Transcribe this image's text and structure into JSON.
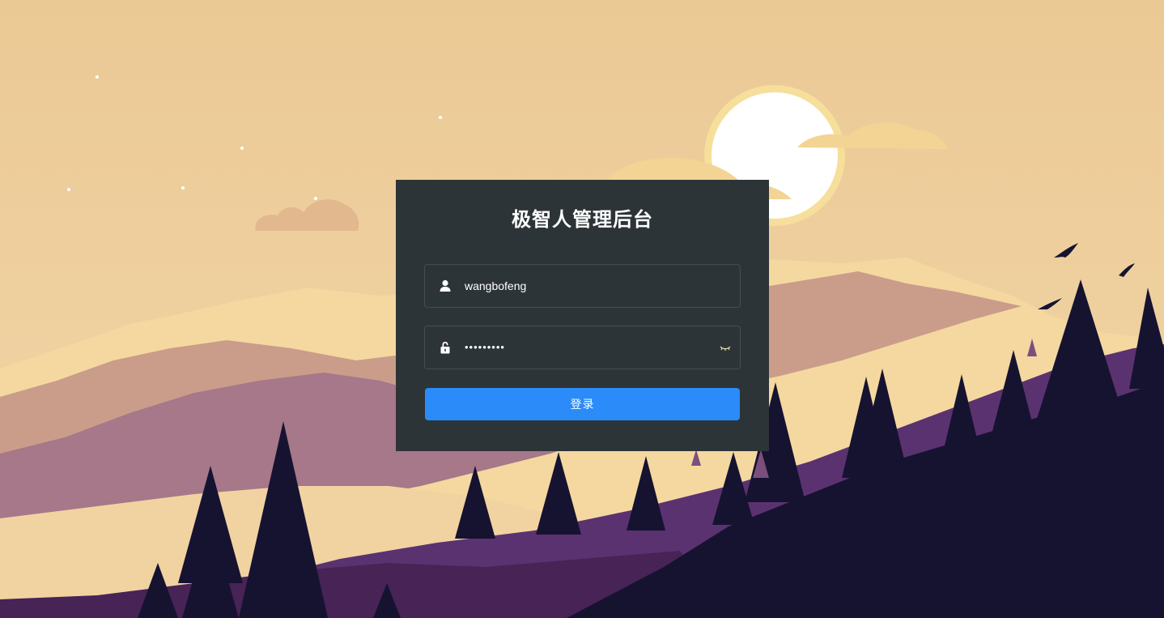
{
  "login": {
    "title": "极智人管理后台",
    "username": {
      "value": "wangbofeng",
      "icon": "user-icon"
    },
    "password": {
      "masked_value": "•••••••••",
      "icon": "lock-icon",
      "toggle_icon": "eye-closed-icon"
    },
    "submit_label": "登录"
  },
  "theme": {
    "panel_bg": "#2d3437",
    "button_bg": "#2a8bf9",
    "sky": "#eccb98"
  }
}
